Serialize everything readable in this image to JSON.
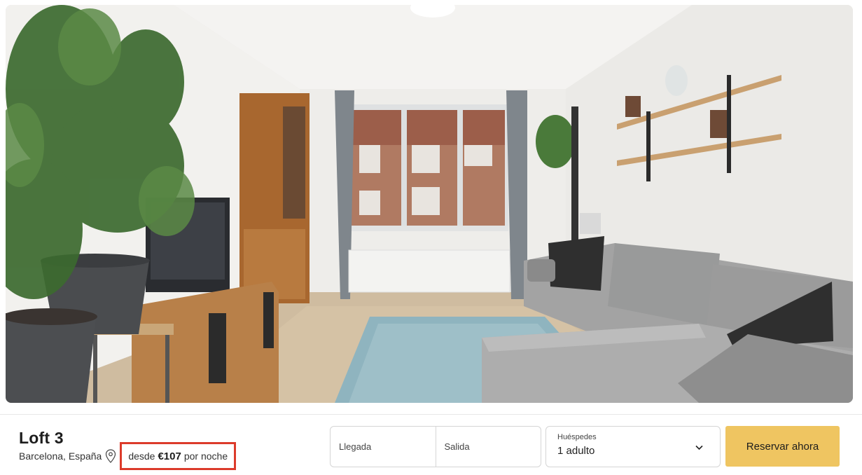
{
  "hero": {
    "icon": "living-room-photo"
  },
  "property": {
    "title": "Loft 3",
    "location": "Barcelona, España",
    "price_prefix": "desde",
    "price": "€107",
    "price_suffix": "por noche"
  },
  "booking": {
    "checkin_label": "Llegada",
    "checkout_label": "Salida",
    "guests_label": "Huéspedes",
    "guests_value": "1 adulto",
    "reserve_label": "Reservar ahora"
  },
  "colors": {
    "reserve_button": "#efc561",
    "price_highlight_border": "#dc3b2b"
  }
}
